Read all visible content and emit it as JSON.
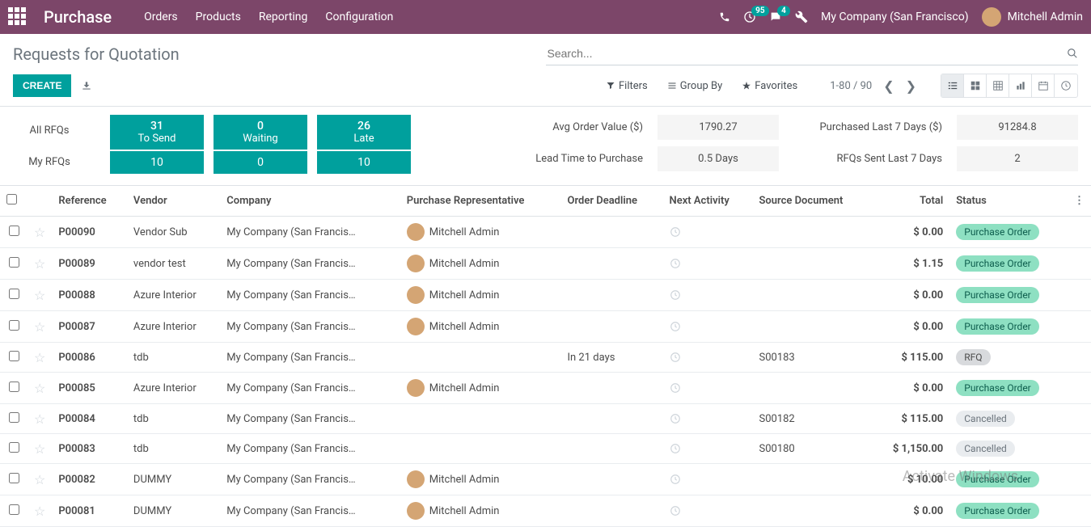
{
  "nav": {
    "brand": "Purchase",
    "menu": [
      "Orders",
      "Products",
      "Reporting",
      "Configuration"
    ],
    "activity_badge": "95",
    "discuss_badge": "4",
    "company": "My Company (San Francisco)",
    "user": "Mitchell Admin"
  },
  "cp": {
    "breadcrumb": "Requests for Quotation",
    "search_placeholder": "Search...",
    "create": "CREATE",
    "filters": "Filters",
    "groupby": "Group By",
    "favorites": "Favorites",
    "pager": "1-80 / 90"
  },
  "dash": {
    "row_labels": [
      "All RFQs",
      "My RFQs"
    ],
    "cols": [
      {
        "top_num": "31",
        "top_lbl": "To Send",
        "bot": "10"
      },
      {
        "top_num": "0",
        "top_lbl": "Waiting",
        "bot": "0"
      },
      {
        "top_num": "26",
        "top_lbl": "Late",
        "bot": "10"
      }
    ],
    "metrics": {
      "avg_lbl": "Avg Order Value ($)",
      "avg_val": "1790.27",
      "purchased_lbl": "Purchased Last 7 Days ($)",
      "purchased_val": "91284.8",
      "lead_lbl": "Lead Time to Purchase",
      "lead_val": "0.5  Days",
      "sent_lbl": "RFQs Sent Last 7 Days",
      "sent_val": "2"
    }
  },
  "table": {
    "headers": {
      "reference": "Reference",
      "vendor": "Vendor",
      "company": "Company",
      "rep": "Purchase Representative",
      "deadline": "Order Deadline",
      "activity": "Next Activity",
      "source": "Source Document",
      "total": "Total",
      "status": "Status"
    },
    "rows": [
      {
        "ref": "P00090",
        "vendor": "Vendor Sub",
        "company": "My Company (San Francisco)",
        "rep": "Mitchell Admin",
        "deadline": "",
        "source": "",
        "total": "$ 0.00",
        "status": "Purchase Order",
        "status_cls": "po"
      },
      {
        "ref": "P00089",
        "vendor": "vendor test",
        "company": "My Company (San Francisco)",
        "rep": "Mitchell Admin",
        "deadline": "",
        "source": "",
        "total": "$ 1.15",
        "status": "Purchase Order",
        "status_cls": "po"
      },
      {
        "ref": "P00088",
        "vendor": "Azure Interior",
        "company": "My Company (San Francisco)",
        "rep": "Mitchell Admin",
        "deadline": "",
        "source": "",
        "total": "$ 0.00",
        "status": "Purchase Order",
        "status_cls": "po"
      },
      {
        "ref": "P00087",
        "vendor": "Azure Interior",
        "company": "My Company (San Francisco)",
        "rep": "Mitchell Admin",
        "deadline": "",
        "source": "",
        "total": "$ 0.00",
        "status": "Purchase Order",
        "status_cls": "po"
      },
      {
        "ref": "P00086",
        "vendor": "tdb",
        "company": "My Company (San Francisco)",
        "rep": "",
        "deadline": "In 21 days",
        "source": "S00183",
        "total": "$ 115.00",
        "status": "RFQ",
        "status_cls": "rfq"
      },
      {
        "ref": "P00085",
        "vendor": "Azure Interior",
        "company": "My Company (San Francisco)",
        "rep": "Mitchell Admin",
        "deadline": "",
        "source": "",
        "total": "$ 0.00",
        "status": "Purchase Order",
        "status_cls": "po"
      },
      {
        "ref": "P00084",
        "vendor": "tdb",
        "company": "My Company (San Francisco)",
        "rep": "",
        "deadline": "",
        "source": "S00182",
        "total": "$ 115.00",
        "status": "Cancelled",
        "status_cls": "cancel"
      },
      {
        "ref": "P00083",
        "vendor": "tdb",
        "company": "My Company (San Francisco)",
        "rep": "",
        "deadline": "",
        "source": "S00180",
        "total": "$ 1,150.00",
        "status": "Cancelled",
        "status_cls": "cancel"
      },
      {
        "ref": "P00082",
        "vendor": "DUMMY",
        "company": "My Company (San Francisco)",
        "rep": "Mitchell Admin",
        "deadline": "",
        "source": "",
        "total": "$ 10.00",
        "status": "Purchase Order",
        "status_cls": "po"
      },
      {
        "ref": "P00081",
        "vendor": "DUMMY",
        "company": "My Company (San Francisco)",
        "rep": "Mitchell Admin",
        "deadline": "",
        "source": "",
        "total": "$ 0.00",
        "status": "Purchase Order",
        "status_cls": "po"
      }
    ]
  },
  "watermark": "Activate Windows"
}
